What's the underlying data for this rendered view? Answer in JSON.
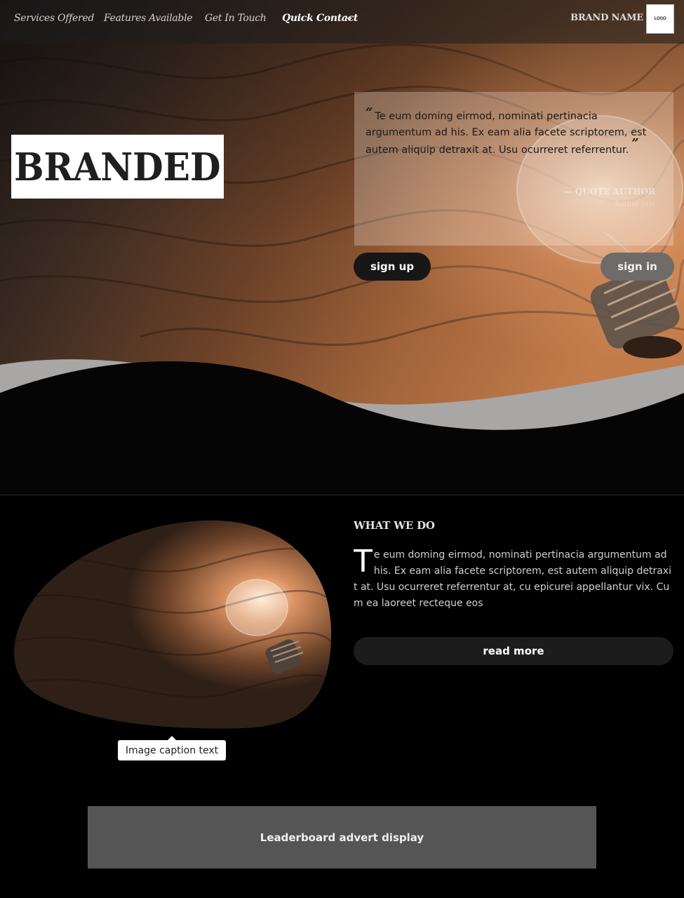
{
  "nav": {
    "items": [
      {
        "label": "Services Offered"
      },
      {
        "label": "Features Available"
      },
      {
        "label": "Get In Touch"
      },
      {
        "label": "Quick Contact"
      }
    ],
    "brand_name": "BRAND NAME",
    "brand_logo_text": "LOGO"
  },
  "hero": {
    "logo_text": "BRANDED",
    "quote": {
      "open_mark": "“",
      "text": "Te eum doming eirmod, nominati pertinacia argumentum ad his. Ex eam alia facete scriptorem, est autem aliquip detraxit at. Usu ocurreret referrentur.",
      "close_mark": "”",
      "author": "— QUOTE AUTHOR",
      "role": "Author role"
    },
    "signup_label": "sign up",
    "signin_label": "sign in"
  },
  "what_we_do": {
    "title": "WHAT WE DO",
    "dropcap": "T",
    "body": "e eum doming eirmod, nominati pertinacia argumentum ad his. Ex eam alia facete scriptorem, est autem aliquip detraxit at. Usu ocurreret referrentur at, cu epicurei appellantur vix. Cum ea laoreet recteque eos",
    "readmore_label": "read more",
    "caption": "Image caption text"
  },
  "advert": {
    "label": "Leaderboard advert display"
  },
  "colors": {
    "wood_dark": "#2a1a12",
    "wood_mid": "#7a4a2c",
    "wood_light": "#c27a48",
    "background": "#000000",
    "button_dark": "#171717",
    "button_grey": "#6f6b69",
    "advert_bg": "#555555"
  }
}
